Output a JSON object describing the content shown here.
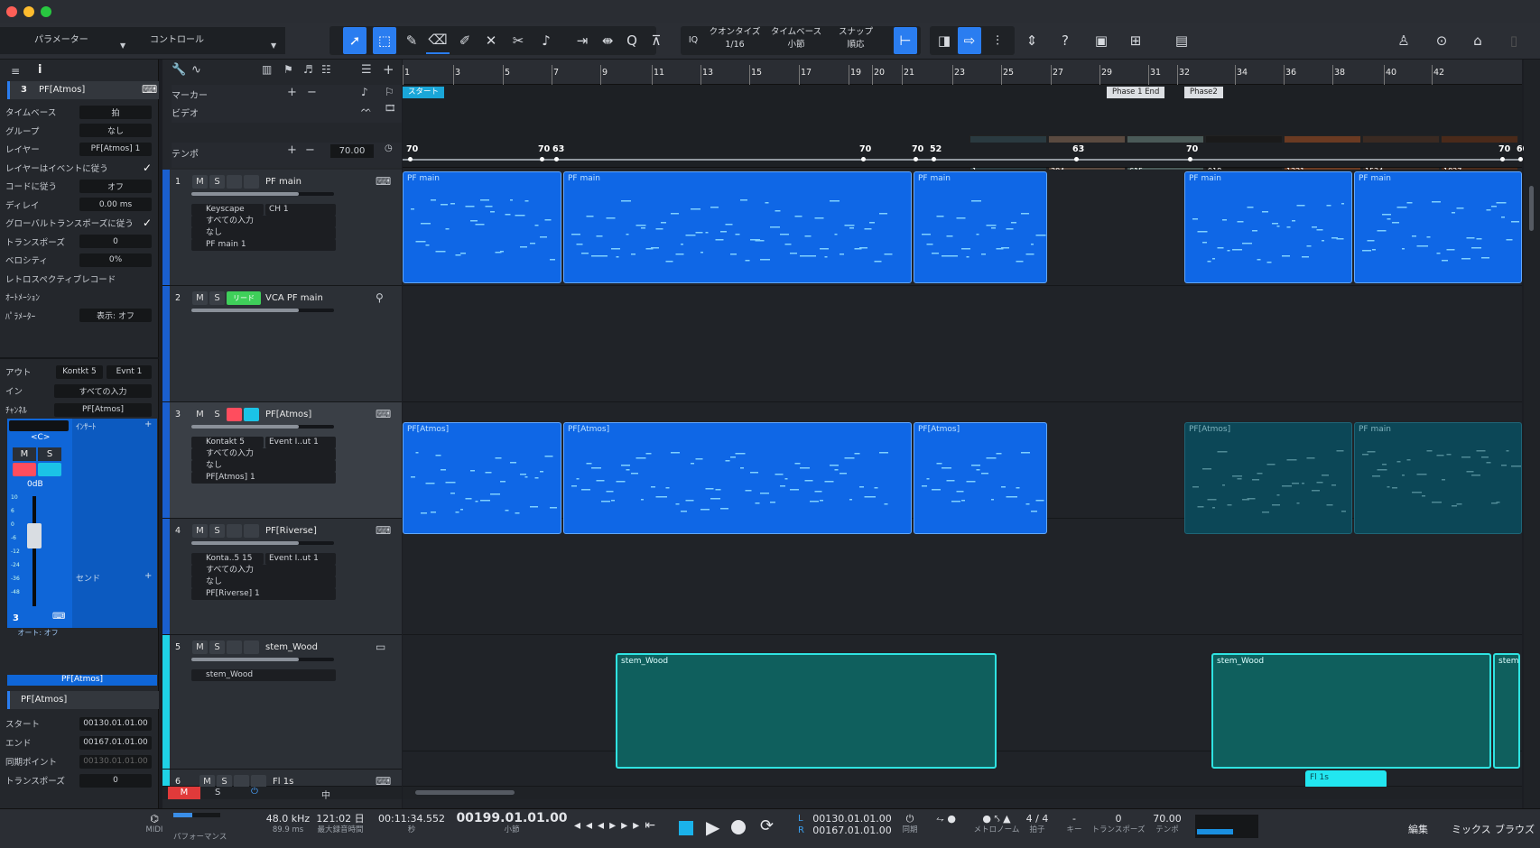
{
  "toolbar": {
    "param_label": "パラメーター",
    "control_label": "コントロール",
    "iq_label": "IQ",
    "quantize_label": "クオンタイズ",
    "quantize_value": "1/16",
    "timebase_label": "タイムベース",
    "timebase_value": "小節",
    "snap_label": "スナップ",
    "snap_value": "順応",
    "icons": [
      "arrow-tool-icon",
      "range-tool-icon",
      "pencil-icon",
      "eraser-icon",
      "paint-icon",
      "mute-tool-icon",
      "split-icon",
      "listen-icon",
      "bend-icon",
      "stretch-icon",
      "quantize-icon",
      "q-icon",
      "snap-icon",
      "loop-icon",
      "cursor-follow-icon",
      "ripple-icon",
      "help-icon",
      "video-icon",
      "grid-icon",
      "layout-icon",
      "user-icon",
      "share-icon",
      "home-icon",
      "doc-icon"
    ]
  },
  "inspector": {
    "track_number": "3",
    "track_name": "PF[Atmos]",
    "rows": [
      {
        "label": "タイムベース",
        "value": "拍"
      },
      {
        "label": "グループ",
        "value": "なし"
      },
      {
        "label": "レイヤー",
        "value": "PF[Atmos] 1"
      },
      {
        "label": "レイヤーはイベントに従う",
        "value": "✓"
      },
      {
        "label": "コードに従う",
        "value": "オフ"
      },
      {
        "label": "ディレイ",
        "value": "0.00 ms"
      },
      {
        "label": "グローバルトランスポーズに従う",
        "value": "✓"
      },
      {
        "label": "トランスポーズ",
        "value": "0"
      },
      {
        "label": "ベロシティ",
        "value": "0%"
      },
      {
        "label": "レトロスペクティブレコード",
        "value": ""
      },
      {
        "label": "ｵｰﾄﾒｰｼｮﾝ",
        "value": ""
      },
      {
        "label": "ﾊﾟﾗﾒｰﾀｰ",
        "value": "表示: オフ"
      }
    ],
    "io": [
      {
        "label": "アウト",
        "value": "Kontkt 5",
        "value2": "Evnt 1"
      },
      {
        "label": "イン",
        "value": "すべての入力"
      },
      {
        "label": "ﾁｬﾝﾈﾙ",
        "value": "PF[Atmos]"
      }
    ],
    "insert_label": "ｲﾝｻｰﾄ",
    "send_label": "センド",
    "pan_label": "<C>",
    "db_label": "0dB",
    "ch_num": "3",
    "auto_label": "オート: オフ",
    "channel_footer": "PF[Atmos]",
    "fader_scale": [
      "10",
      "6",
      "0",
      "-6",
      "-12",
      "-24",
      "-36",
      "-48"
    ],
    "event": {
      "name": "PF[Atmos]",
      "rows": [
        {
          "label": "スタート",
          "value": "00130.01.01.00"
        },
        {
          "label": "エンド",
          "value": "00167.01.01.00"
        },
        {
          "label": "同期ポイント",
          "value": "00130.01.01.00"
        },
        {
          "label": "トランスポーズ",
          "value": "0"
        }
      ]
    }
  },
  "globals": {
    "marker_label": "マーカー",
    "video_label": "ビデオ",
    "tempo_label": "テンポ",
    "tempo_value": "70.00"
  },
  "tracks": [
    {
      "num": "1",
      "name": "PF main",
      "selects": [
        "Keyscape",
        "すべての入力",
        "なし",
        "PF main 1"
      ],
      "sel2": "CH 1"
    },
    {
      "num": "2",
      "name": "VCA PF main",
      "lead": "リード"
    },
    {
      "num": "3",
      "name": "PF[Atmos]",
      "selects": [
        "Kontakt 5",
        "すべての入力",
        "なし",
        "PF[Atmos] 1"
      ],
      "sel2": "Event I..ut 1"
    },
    {
      "num": "4",
      "name": "PF[Riverse]",
      "selects": [
        "Konta..5 15",
        "すべての入力",
        "なし",
        "PF[Riverse] 1"
      ],
      "sel2": "Event I..ut 1"
    },
    {
      "num": "5",
      "name": "stem_Wood",
      "selects": [
        "stem_Wood"
      ]
    },
    {
      "num": "6",
      "name": "Fl 1s"
    }
  ],
  "ruler": [
    "1",
    "3",
    "5",
    "7",
    "9",
    "11",
    "13",
    "15",
    "17",
    "19",
    "20",
    "21",
    "23",
    "25",
    "27",
    "29",
    "31",
    "32",
    "34",
    "36",
    "38",
    "40",
    "42"
  ],
  "markers": [
    "スタート",
    "Phase 1 End",
    "Phase2"
  ],
  "video_frames": [
    "1",
    "304",
    "615",
    "918",
    "1221",
    "1524",
    "1827"
  ],
  "tempo_points": [
    "70",
    "70",
    "63",
    "70",
    "70",
    "52",
    "63",
    "70",
    "70",
    "60"
  ],
  "clips": {
    "track1": [
      "PF main",
      "PF main",
      "PF main",
      "PF main",
      "PF main"
    ],
    "track3": [
      "PF[Atmos]",
      "PF[Atmos]",
      "PF[Atmos]",
      "PF[Atmos]",
      "PF main"
    ],
    "track5": [
      "stem_Wood",
      "stem_Wood",
      "stem_"
    ],
    "track6": [
      "Fl 1s"
    ]
  },
  "bottom_tabs": {
    "m": "M",
    "s": "S",
    "mid": "中"
  },
  "transport": {
    "midi_label": "MIDI",
    "perf_label": "パフォーマンス",
    "sample_rate": "48.0 kHz",
    "latency": "89.9 ms",
    "rec_time": "121:02 日",
    "rec_time_label": "最大録音時間",
    "time_sec": "00:11:34.552",
    "time_sec_label": "秒",
    "position": "00199.01.01.00",
    "position_label": "小節",
    "loop_l": "00130.01.01.00",
    "loop_r": "00167.01.01.00",
    "sync_label": "同期",
    "metronome_label": "メトロノーム",
    "time_sig": "4 / 4",
    "time_sig_label": "拍子",
    "key": "-",
    "key_label": "キー",
    "transpose": "0",
    "transpose_label": "トランスポーズ",
    "tempo": "70.00",
    "tempo_label": "テンポ",
    "edit_label": "編集",
    "mix_label": "ミックス",
    "browse_label": "ブラウズ"
  }
}
